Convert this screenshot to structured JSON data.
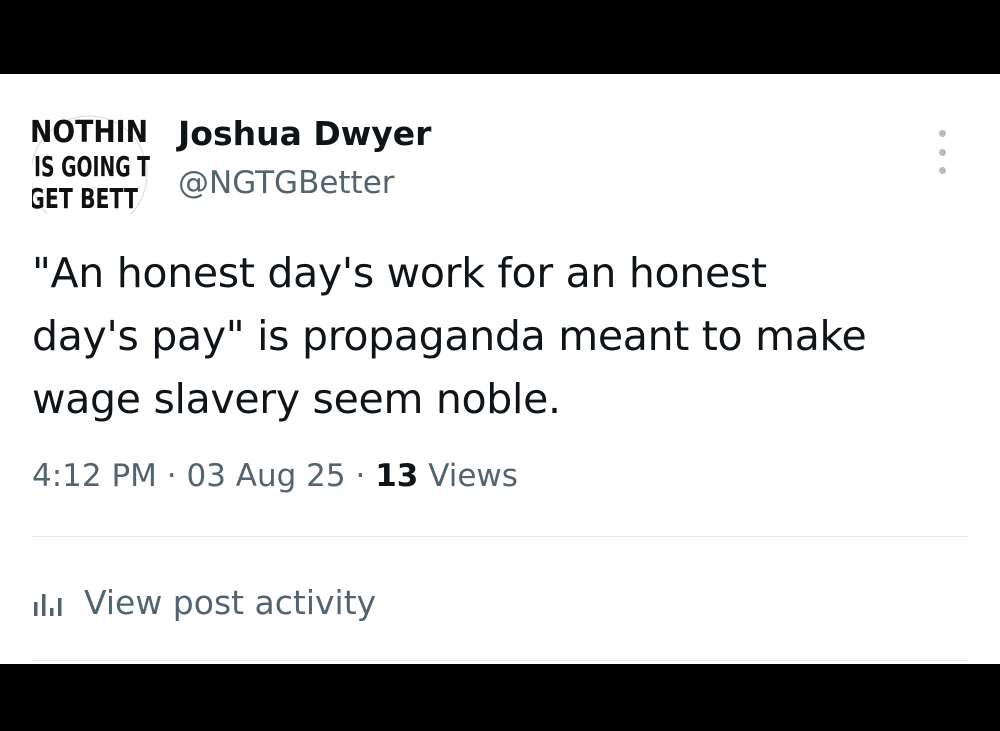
{
  "post": {
    "author": {
      "name": "Joshua Dwyer",
      "handle": "@NGTGBetter",
      "avatar_text": [
        "NOTHIN",
        "IS GOING T",
        "GET BETT"
      ]
    },
    "text_lines": [
      "\"An honest day's work for an honest",
      "day's pay\" is propaganda meant to make",
      "wage slavery seem noble."
    ],
    "meta": {
      "time": "4:12 PM",
      "separator": "·",
      "date": "03 Aug 25",
      "views_count": "13",
      "views_label": "Views"
    },
    "activity_label": "View post activity",
    "icons": {
      "more": "more-options-icon",
      "activity": "bar-chart-icon"
    }
  }
}
